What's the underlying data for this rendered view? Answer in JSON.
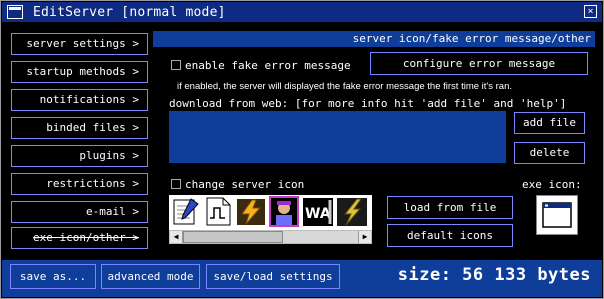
{
  "window": {
    "title": "EditServer [normal mode]",
    "close_glyph": "×"
  },
  "sidebar": {
    "items": [
      {
        "label": "server settings >"
      },
      {
        "label": "startup methods >"
      },
      {
        "label": "notifications >"
      },
      {
        "label": "binded files >"
      },
      {
        "label": "plugins >"
      },
      {
        "label": "restrictions >"
      },
      {
        "label": "e-mail >"
      },
      {
        "label": "exe icon/other >"
      }
    ]
  },
  "main": {
    "header": "server icon/fake error message/other",
    "fake_error": {
      "checkbox_label": "enable fake error message",
      "configure_button": "configure error message",
      "info": "if enabled, the server will displayed the fake error message the first time it's ran."
    },
    "download": {
      "label": "download from web: [for more info hit 'add file' and 'help']",
      "add_button": "add file",
      "delete_button": "delete"
    },
    "icon": {
      "checkbox_label": "change server icon",
      "exe_icon_label": "exe icon:",
      "load_button": "load from file",
      "default_button": "default icons",
      "icons": [
        "notepad-pen-icon",
        "pulse-document-icon",
        "winamp-bolt-icon",
        "avatar-character-icon",
        "winamp-logo-icon",
        "lightning-icon"
      ],
      "exe_preview": "window-app-icon"
    }
  },
  "bottom": {
    "save_as": "save as...",
    "advanced": "advanced mode",
    "save_load": "save/load settings",
    "size_text": "size: 56 133 bytes"
  },
  "colors": {
    "accent": "#0f3d9a",
    "titlebar": "#0f2a82",
    "border": "#7a86ff",
    "background": "#000000"
  }
}
